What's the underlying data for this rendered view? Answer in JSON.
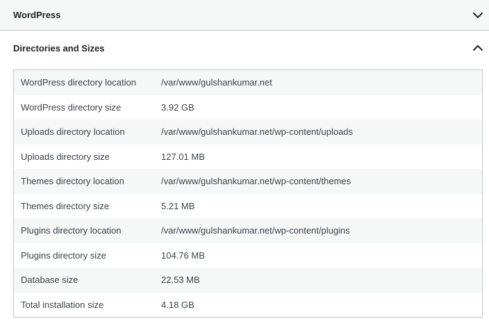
{
  "sections": {
    "wordpress": {
      "title": "WordPress",
      "icon": "chevron-down-icon"
    },
    "directories": {
      "title": "Directories and Sizes",
      "icon": "chevron-up-icon"
    }
  },
  "rows": [
    {
      "label": "WordPress directory location",
      "value": "/var/www/gulshankumar.net"
    },
    {
      "label": "WordPress directory size",
      "value": "3.92 GB"
    },
    {
      "label": "Uploads directory location",
      "value": "/var/www/gulshankumar.net/wp-content/uploads"
    },
    {
      "label": "Uploads directory size",
      "value": "127.01 MB"
    },
    {
      "label": "Themes directory location",
      "value": "/var/www/gulshankumar.net/wp-content/themes"
    },
    {
      "label": "Themes directory size",
      "value": "5.21 MB"
    },
    {
      "label": "Plugins directory location",
      "value": "/var/www/gulshankumar.net/wp-content/plugins"
    },
    {
      "label": "Plugins directory size",
      "value": "104.76 MB"
    },
    {
      "label": "Database size",
      "value": "22.53 MB"
    },
    {
      "label": "Total installation size",
      "value": "4.18 GB"
    }
  ]
}
